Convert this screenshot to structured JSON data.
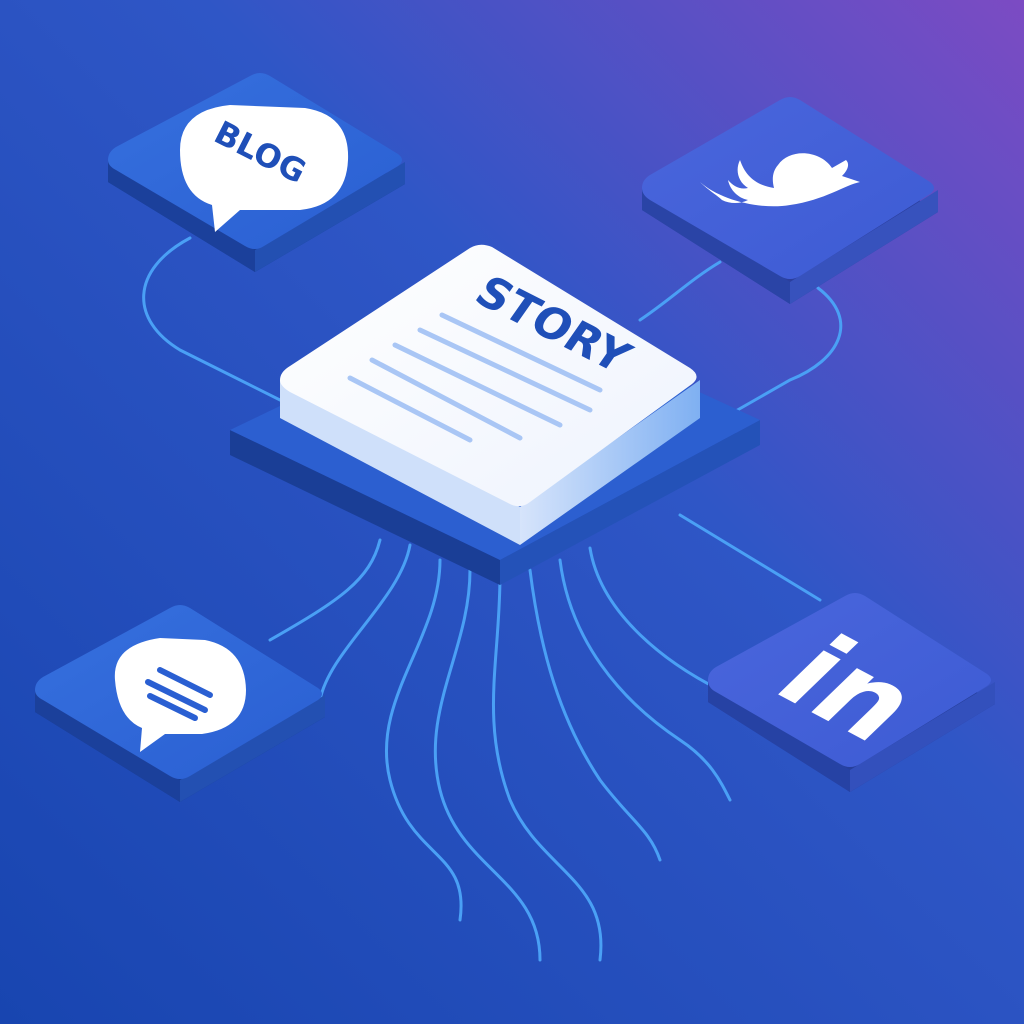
{
  "scene": {
    "story_label": "STORY",
    "blog_label": "BLOG",
    "linkedin_label": "in",
    "icons": {
      "blog": "blog-speech-bubble-icon",
      "twitter": "twitter-bird-icon",
      "message": "message-bubble-icon",
      "linkedin": "linkedin-icon",
      "story": "story-document-icon"
    },
    "colors": {
      "bg_start": "#1a48b4",
      "bg_end": "#7a4bc4",
      "tile": "#2f66d6",
      "tile_side": "#1d44a4",
      "tile_shadow": "#173b94",
      "story_top": "#ffffff",
      "story_text": "#1f4fb8",
      "connector": "#4aa0f5"
    }
  }
}
